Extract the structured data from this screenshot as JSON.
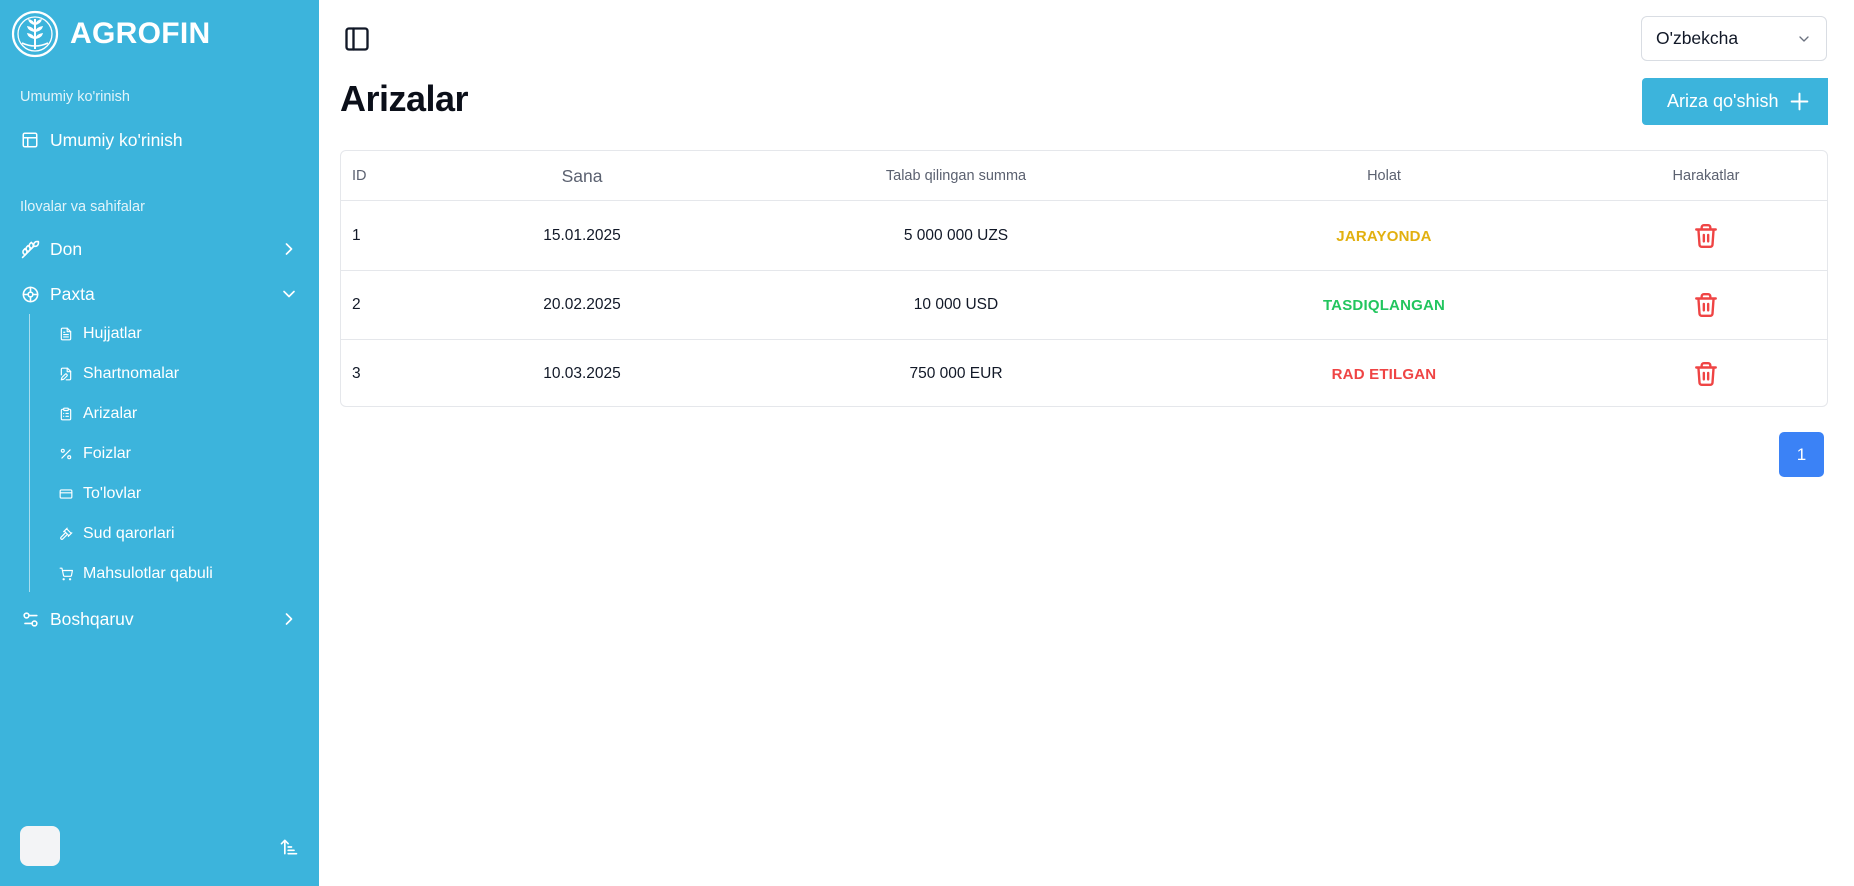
{
  "brand": {
    "name": "AGROFIN"
  },
  "sidebar": {
    "section_overview": "Umumiy ko'rinish",
    "overview_item": {
      "label": "Umumiy ko'rinish",
      "icon": "layout-icon"
    },
    "section_apps": "Ilovalar va sahifalar",
    "groups": [
      {
        "label": "Don",
        "icon": "wheat-icon",
        "expanded": false
      },
      {
        "label": "Paxta",
        "icon": "cotton-icon",
        "expanded": true
      },
      {
        "label": "Boshqaruv",
        "icon": "settings-sliders-icon",
        "expanded": false
      }
    ],
    "paxta_items": [
      {
        "label": "Hujjatlar",
        "icon": "file-text-icon"
      },
      {
        "label": "Shartnomalar",
        "icon": "file-edit-icon"
      },
      {
        "label": "Arizalar",
        "icon": "clipboard-icon"
      },
      {
        "label": "Foizlar",
        "icon": "percent-icon"
      },
      {
        "label": "To'lovlar",
        "icon": "credit-card-icon"
      },
      {
        "label": "Sud qarorlari",
        "icon": "gavel-icon"
      },
      {
        "label": "Mahsulotlar qabuli",
        "icon": "cart-icon"
      }
    ]
  },
  "header": {
    "language": "O'zbekcha"
  },
  "page": {
    "title": "Arizalar",
    "add_button": "Ariza qo'shish"
  },
  "table": {
    "columns": {
      "id": "ID",
      "date": "Sana",
      "amount": "Talab qilingan summa",
      "status": "Holat",
      "actions": "Harakatlar"
    },
    "rows": [
      {
        "id": "1",
        "date": "15.01.2025",
        "amount": "5 000 000 UZS",
        "status": "JARAYONDA",
        "status_color": "#e2b00f"
      },
      {
        "id": "2",
        "date": "20.02.2025",
        "amount": "10 000 USD",
        "status": "TASDIQLANGAN",
        "status_color": "#22c55e"
      },
      {
        "id": "3",
        "date": "10.03.2025",
        "amount": "750 000 EUR",
        "status": "RAD ETILGAN",
        "status_color": "#ef4444"
      }
    ]
  },
  "pagination": {
    "current_page": "1"
  },
  "colors": {
    "sidebar_bg": "#3cb4dc",
    "primary": "#3cb4dc",
    "page_active": "#3b82f6",
    "delete": "#ef4444"
  }
}
